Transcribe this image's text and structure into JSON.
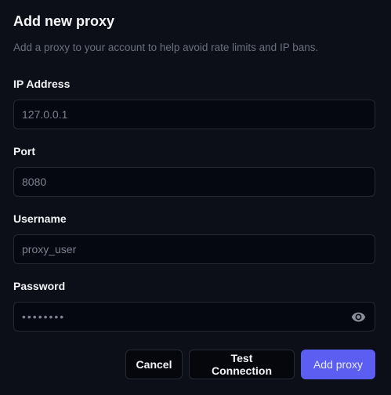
{
  "dialog": {
    "title": "Add new proxy",
    "subtitle": "Add a proxy to your account to help avoid rate limits and IP bans."
  },
  "fields": {
    "ip": {
      "label": "IP Address",
      "placeholder": "127.0.0.1"
    },
    "port": {
      "label": "Port",
      "placeholder": "8080"
    },
    "username": {
      "label": "Username",
      "placeholder": "proxy_user"
    },
    "password": {
      "label": "Password",
      "value": "••••••••",
      "toggle_icon": "eye-icon"
    }
  },
  "buttons": {
    "cancel": "Cancel",
    "test": "Test Connection",
    "add": "Add proxy"
  },
  "colors": {
    "background": "#0c0f18",
    "input_background": "#050810",
    "border": "#262a36",
    "primary": "#5b5ef0",
    "muted_text": "#6b7080"
  }
}
